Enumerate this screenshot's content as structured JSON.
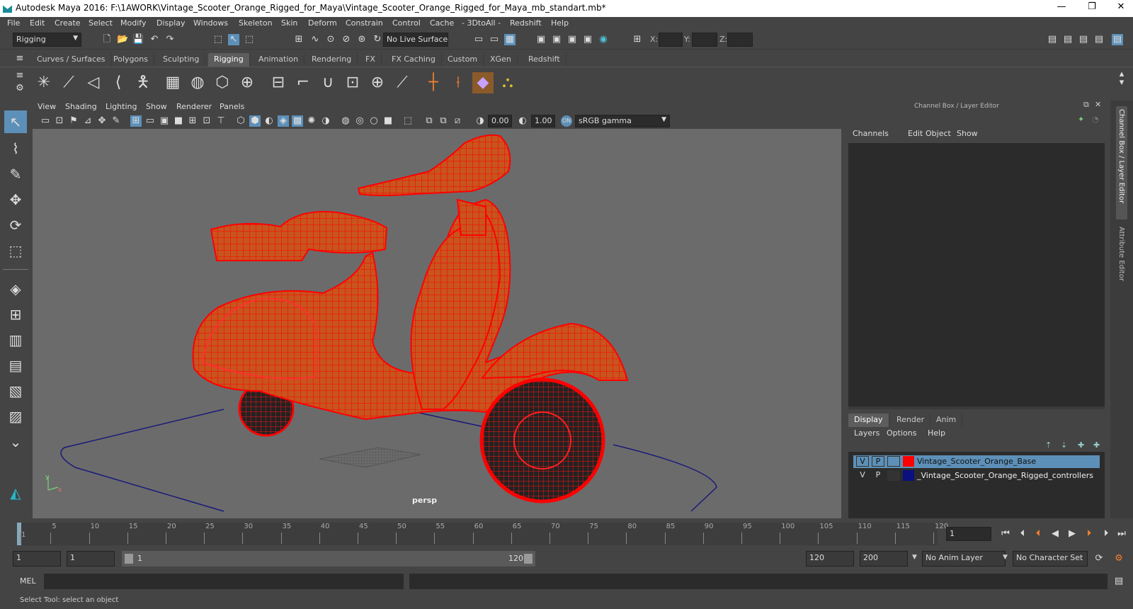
{
  "titlebar": {
    "title": "Autodesk Maya 2016: F:\\1AWORK\\Vintage_Scooter_Orange_Rigged_for_Maya\\Vintage_Scooter_Orange_Rigged_for_Maya_mb_standart.mb*",
    "minimize": "—",
    "restore": "❐",
    "close": "✕"
  },
  "menubar": [
    "File",
    "Edit",
    "Create",
    "Select",
    "Modify",
    "Display",
    "Windows",
    "Skeleton",
    "Skin",
    "Deform",
    "Constrain",
    "Control",
    "Cache",
    "- 3DtoAll -",
    "Redshift",
    "Help"
  ],
  "statusline": {
    "mode": "Rigging",
    "live_surface": "No Live Surface",
    "x_label": "X:",
    "y_label": "Y:",
    "z_label": "Z:"
  },
  "shelf_tabs": [
    "Curves / Surfaces",
    "Polygons",
    "Sculpting",
    "Rigging",
    "Animation",
    "Rendering",
    "FX",
    "FX Caching",
    "Custom",
    "XGen",
    "Redshift"
  ],
  "shelf_active": "Rigging",
  "viewport": {
    "menu": [
      "View",
      "Shading",
      "Lighting",
      "Show",
      "Renderer",
      "Panels"
    ],
    "exposure": "0.00",
    "gamma": "1.00",
    "color_space": "sRGB gamma",
    "camera": "persp"
  },
  "channel_box": {
    "title": "Channel Box / Layer Editor",
    "menu": [
      "Channels",
      "Edit",
      "Object",
      "Show"
    ]
  },
  "layer_editor": {
    "tabs": [
      "Display",
      "Render",
      "Anim"
    ],
    "menu": [
      "Layers",
      "Options",
      "Help"
    ],
    "layers": [
      {
        "v": "V",
        "p": "P",
        "name": "Vintage_Scooter_Orange_Base",
        "color": "#ff0000",
        "selected": true
      },
      {
        "v": "V",
        "p": "P",
        "name": "_Vintage_Scooter_Orange_Rigged_controllers",
        "color": "#0a1080",
        "selected": false
      }
    ]
  },
  "side_tabs": {
    "channel": "Channel Box / Layer Editor",
    "attribute": "Attribute Editor"
  },
  "timeline": {
    "ticks": [
      "1",
      "5",
      "10",
      "15",
      "20",
      "25",
      "30",
      "35",
      "40",
      "45",
      "50",
      "55",
      "60",
      "65",
      "70",
      "75",
      "80",
      "85",
      "90",
      "95",
      "100",
      "105",
      "110",
      "115",
      "120"
    ],
    "current_frame": "1"
  },
  "range": {
    "start": "1",
    "playback_start": "1",
    "slider_start": "1",
    "slider_end": "120",
    "playback_end": "120",
    "end": "200",
    "anim_layer": "No Anim Layer",
    "character_set": "No Character Set"
  },
  "mel": {
    "label": "MEL"
  },
  "help_line": "Select Tool: select an object",
  "colors": {
    "accent": "#5d90b8",
    "wire": "#ff0000",
    "body": "#c8541e",
    "ground": "#1a1a7a"
  }
}
